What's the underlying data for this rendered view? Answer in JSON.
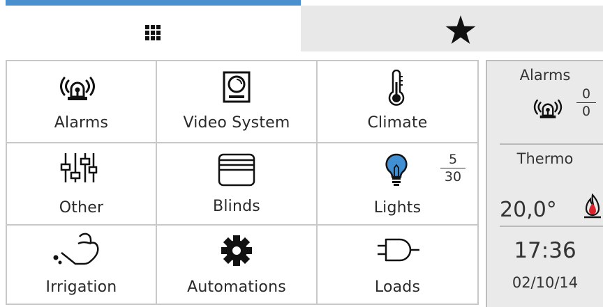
{
  "tabs": [
    {
      "name": "apps",
      "icon": "grid-icon",
      "active": true
    },
    {
      "name": "favorites",
      "icon": "star-icon",
      "active": false
    }
  ],
  "colors": {
    "accent": "#4a90cf",
    "bulb": "#3f8fd2",
    "flame": "#d8232a"
  },
  "grid": {
    "alarms": {
      "label": "Alarms",
      "icon": "alarm-siren-icon"
    },
    "video": {
      "label": "Video System",
      "icon": "video-door-panel-icon"
    },
    "climate": {
      "label": "Climate",
      "icon": "thermometer-icon"
    },
    "other": {
      "label": "Other",
      "icon": "sliders-icon"
    },
    "blinds": {
      "label": "Blinds",
      "icon": "blinds-icon"
    },
    "lights": {
      "label": "Lights",
      "icon": "light-bulb-icon",
      "on": "5",
      "total": "30"
    },
    "irrigation": {
      "label": "Irrigation",
      "icon": "watering-can-icon"
    },
    "automations": {
      "label": "Automations",
      "icon": "gear-icon"
    },
    "loads": {
      "label": "Loads",
      "icon": "plug-icon"
    }
  },
  "side": {
    "alarms_title": "Alarms",
    "alarms_active": "0",
    "alarms_total": "0",
    "thermo_title": "Thermo",
    "temperature": "20,0°",
    "time": "17:36",
    "date": "02/10/14"
  }
}
